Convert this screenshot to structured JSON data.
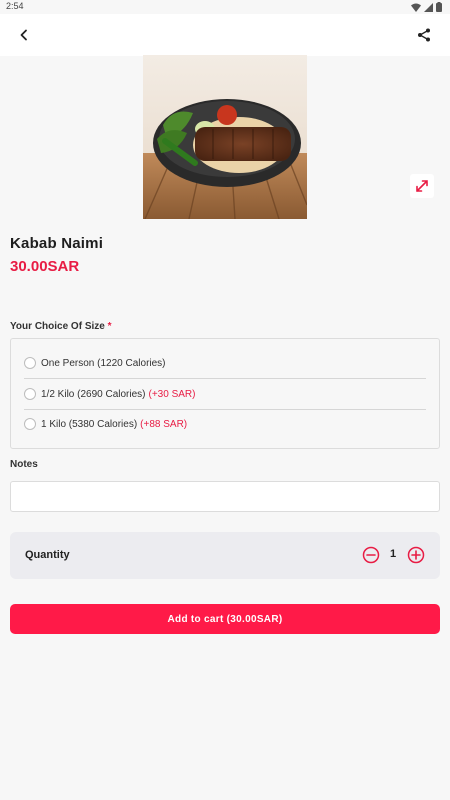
{
  "status_bar": {
    "time": "2:54"
  },
  "product": {
    "name": "Kabab Naimi",
    "price": "30.00SAR"
  },
  "size_section": {
    "label": "Your Choice Of Size",
    "required_marker": "*",
    "options": [
      {
        "label": "One Person (1220 Calories)",
        "extra": ""
      },
      {
        "label": "1/2 Kilo (2690 Calories)",
        "extra": "(+30 SAR)"
      },
      {
        "label": "1 Kilo (5380 Calories)",
        "extra": "(+88 SAR)"
      }
    ]
  },
  "notes": {
    "label": "Notes",
    "value": "",
    "placeholder": ""
  },
  "quantity": {
    "label": "Quantity",
    "value": "1"
  },
  "cart": {
    "button_label": "Add to cart (30.00SAR)"
  },
  "icons": {
    "back": "chevron-left-icon",
    "share": "share-icon",
    "expand": "expand-icon",
    "minus": "minus-circle-icon",
    "plus": "plus-circle-icon"
  },
  "colors": {
    "accent": "#e81c44",
    "button": "#ff1a48"
  }
}
